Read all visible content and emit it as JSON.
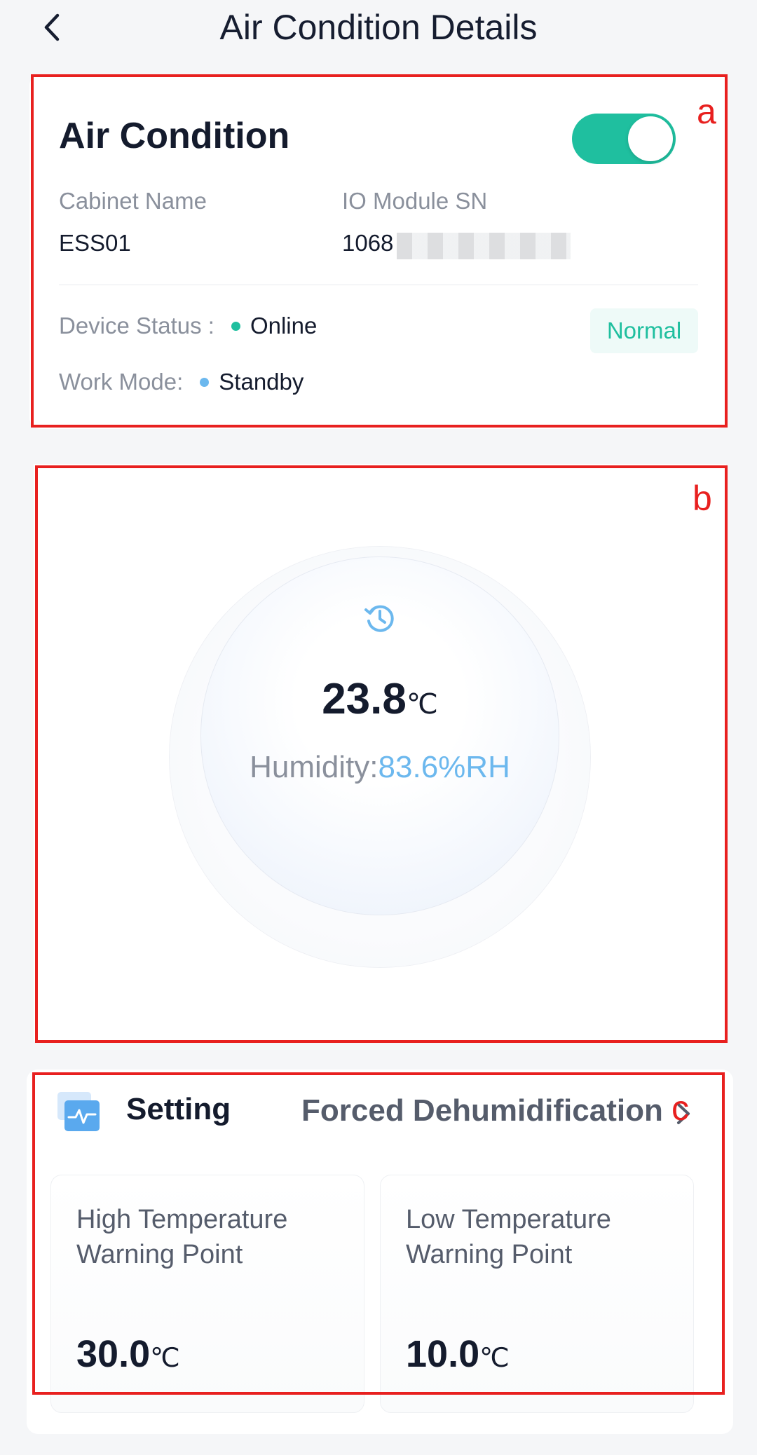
{
  "header": {
    "title": "Air Condition Details"
  },
  "device": {
    "name": "Air Condition",
    "power_on": true,
    "cabinet_label": "Cabinet Name",
    "cabinet_value": "ESS01",
    "sn_label": "IO Module SN",
    "sn_value": "1068",
    "status_label": "Device Status :",
    "status_value": "Online",
    "mode_label": "Work Mode:",
    "mode_value": "Standby",
    "badge": "Normal"
  },
  "gauge": {
    "temperature": "23.8",
    "temperature_unit": "℃",
    "humidity_label": "Humidity:",
    "humidity_value": "83.6%RH"
  },
  "setting": {
    "title": "Setting",
    "mode": "Forced Dehumidification",
    "high_label": "High Temperature Warning Point",
    "high_value": "30.0",
    "high_unit": "℃",
    "low_label": "Low Temperature Warning Point",
    "low_value": "10.0",
    "low_unit": "℃"
  },
  "annotations": {
    "a": "a",
    "b": "b",
    "c": "c"
  },
  "colors": {
    "accent": "#1fbf9f",
    "online_dot": "#1fbf9f",
    "standby_dot": "#6cb8ee",
    "humidity": "#6cb8ee",
    "annotation": "#e8201f"
  }
}
